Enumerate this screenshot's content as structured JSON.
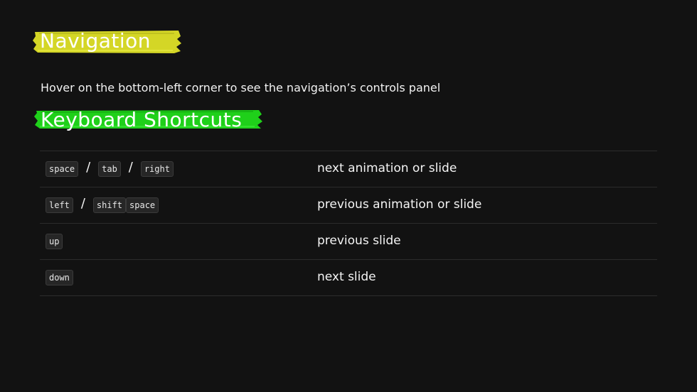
{
  "colors": {
    "background": "#121212",
    "navigation_marker": "#d4d626",
    "shortcuts_marker": "#1fd01a",
    "text": "#f2f2f2"
  },
  "navigation": {
    "title": "Navigation",
    "description": "Hover on the bottom-left corner to see the navigation’s controls panel"
  },
  "keyboard": {
    "title": "Keyboard Shortcuts",
    "separator": "/",
    "rows": [
      {
        "keys_a": [
          "space"
        ],
        "keys_b": [
          "tab"
        ],
        "keys_c": [
          "right"
        ],
        "action": "next animation or slide"
      },
      {
        "keys_a": [
          "left"
        ],
        "keys_b": [
          "shift",
          "space"
        ],
        "action": "previous animation or slide"
      },
      {
        "keys_a": [
          "up"
        ],
        "action": "previous slide"
      },
      {
        "keys_a": [
          "down"
        ],
        "action": "next slide"
      }
    ]
  }
}
